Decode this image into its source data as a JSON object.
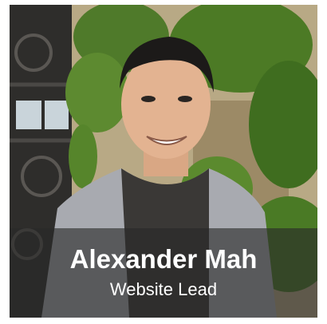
{
  "profile": {
    "name": "Alexander Mah",
    "role": "Website Lead",
    "photo_icon": "portrait-photo"
  },
  "colors": {
    "caption_overlay": "#282828",
    "caption_text": "#ffffff"
  }
}
